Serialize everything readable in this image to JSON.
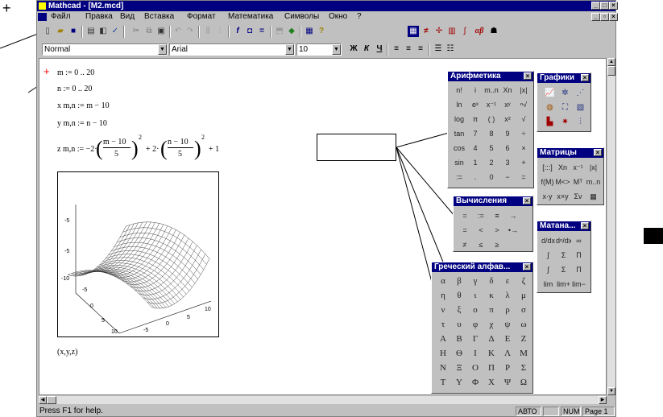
{
  "window": {
    "title": "Mathcad - [M2.mcd]",
    "controls": [
      "_",
      "□",
      "×"
    ]
  },
  "menu": [
    "Файл",
    "Правка",
    "Вид",
    "Вставка",
    "Формат",
    "Математика",
    "Символы",
    "Окно",
    "?"
  ],
  "toolbar": {
    "icons": [
      "new-icon",
      "open-icon",
      "save-icon",
      "print-icon",
      "preview-icon",
      "spell-icon",
      "cut-icon",
      "copy-icon",
      "paste-icon",
      "undo-icon",
      "redo-icon",
      "align-icon",
      "align-bottom-icon",
      "function-icon",
      "units-icon",
      "calc-icon",
      "insert-component-icon",
      "resources-icon",
      "help-icon"
    ],
    "palette_icons": [
      "calculator-palette-icon",
      "evaluation-palette-icon",
      "graph-palette-icon",
      "matrix-palette-icon",
      "calculus-palette-icon",
      "greek-palette-icon",
      "symbolic-palette-icon"
    ],
    "greek_label": "αβ"
  },
  "format": {
    "style": "Normal",
    "font": "Arial",
    "size": "10",
    "bold": "Ж",
    "italic": "К",
    "underline": "Ч"
  },
  "document": {
    "cursor": "+",
    "lines": [
      "m := 0 .. 20",
      "n := 0 .. 20",
      "x m,n := m − 10",
      "y m,n := n − 10"
    ],
    "zdef_lhs": "z m,n := −2·",
    "zdef_part1": "(m − 10 / 5)",
    "zdef_mid": "+ 2·",
    "zdef_part2": "(n − 10 / 5)",
    "zdef_end": "+ 1",
    "frac1_num": "m − 10",
    "frac1_den": "5",
    "frac2_num": "n − 10",
    "frac2_den": "5",
    "exp": "2",
    "plot_label": "(x,y,z)",
    "z_ticks": [
      "-5",
      "-5",
      "-10"
    ],
    "x_ticks": [
      "-5",
      "0",
      "5",
      "10"
    ],
    "y_ticks": [
      "10",
      "5",
      "0",
      "-5"
    ]
  },
  "palettes": {
    "arithmetic": {
      "title": "Арифметика",
      "cells": [
        "n!",
        "i",
        "m..n",
        "Xn",
        "|x|",
        "ln",
        "eˣ",
        "x⁻¹",
        "xʸ",
        "ⁿ√",
        "log",
        "π",
        "( )",
        "x²",
        "√",
        "tan",
        "7",
        "8",
        "9",
        "÷",
        "cos",
        "4",
        "5",
        "6",
        "×",
        "sin",
        "1",
        "2",
        "3",
        "+",
        ":=",
        ".",
        "0",
        "−",
        "="
      ]
    },
    "graphs": {
      "title": "Графики"
    },
    "evaluation": {
      "title": "Вычисления",
      "cells": [
        "=",
        ":=",
        "≡",
        "→",
        "=",
        "<",
        ">",
        "•→",
        "≠",
        "≤",
        "≥"
      ]
    },
    "matrices": {
      "title": "Матрицы",
      "cells": [
        "[:::]",
        "Xn",
        "x⁻¹",
        "|x|",
        "f(M)",
        "M<>",
        "Mᵀ",
        "m..n",
        "x·y",
        "x×y",
        "Σv",
        "▦"
      ]
    },
    "calculus": {
      "title": "Матана...",
      "cells": [
        "d/dx",
        "dⁿ/dxⁿ",
        "∞",
        "∫",
        "Σ",
        "Π",
        "∫",
        "Σ",
        "Π",
        "lim",
        "lim+",
        "lim−"
      ]
    },
    "greek": {
      "title": "Греческий алфав...",
      "cells": [
        "α",
        "β",
        "γ",
        "δ",
        "ε",
        "ζ",
        "η",
        "θ",
        "ι",
        "κ",
        "λ",
        "μ",
        "ν",
        "ξ",
        "ο",
        "π",
        "ρ",
        "σ",
        "τ",
        "υ",
        "φ",
        "χ",
        "ψ",
        "ω",
        "Α",
        "Β",
        "Γ",
        "Δ",
        "Ε",
        "Ζ",
        "Η",
        "Θ",
        "Ι",
        "Κ",
        "Λ",
        "Μ",
        "Ν",
        "Ξ",
        "Ο",
        "Π",
        "Ρ",
        "Σ",
        "Τ",
        "Υ",
        "Φ",
        "Χ",
        "Ψ",
        "Ω"
      ]
    }
  },
  "status": {
    "help": "Press F1 for help.",
    "mode": "АВТО",
    "num": "NUM",
    "page": "Page 1"
  },
  "colors": {
    "titlebar": "#000080",
    "face": "#c0c0c0",
    "cursor": "#ff0000"
  }
}
